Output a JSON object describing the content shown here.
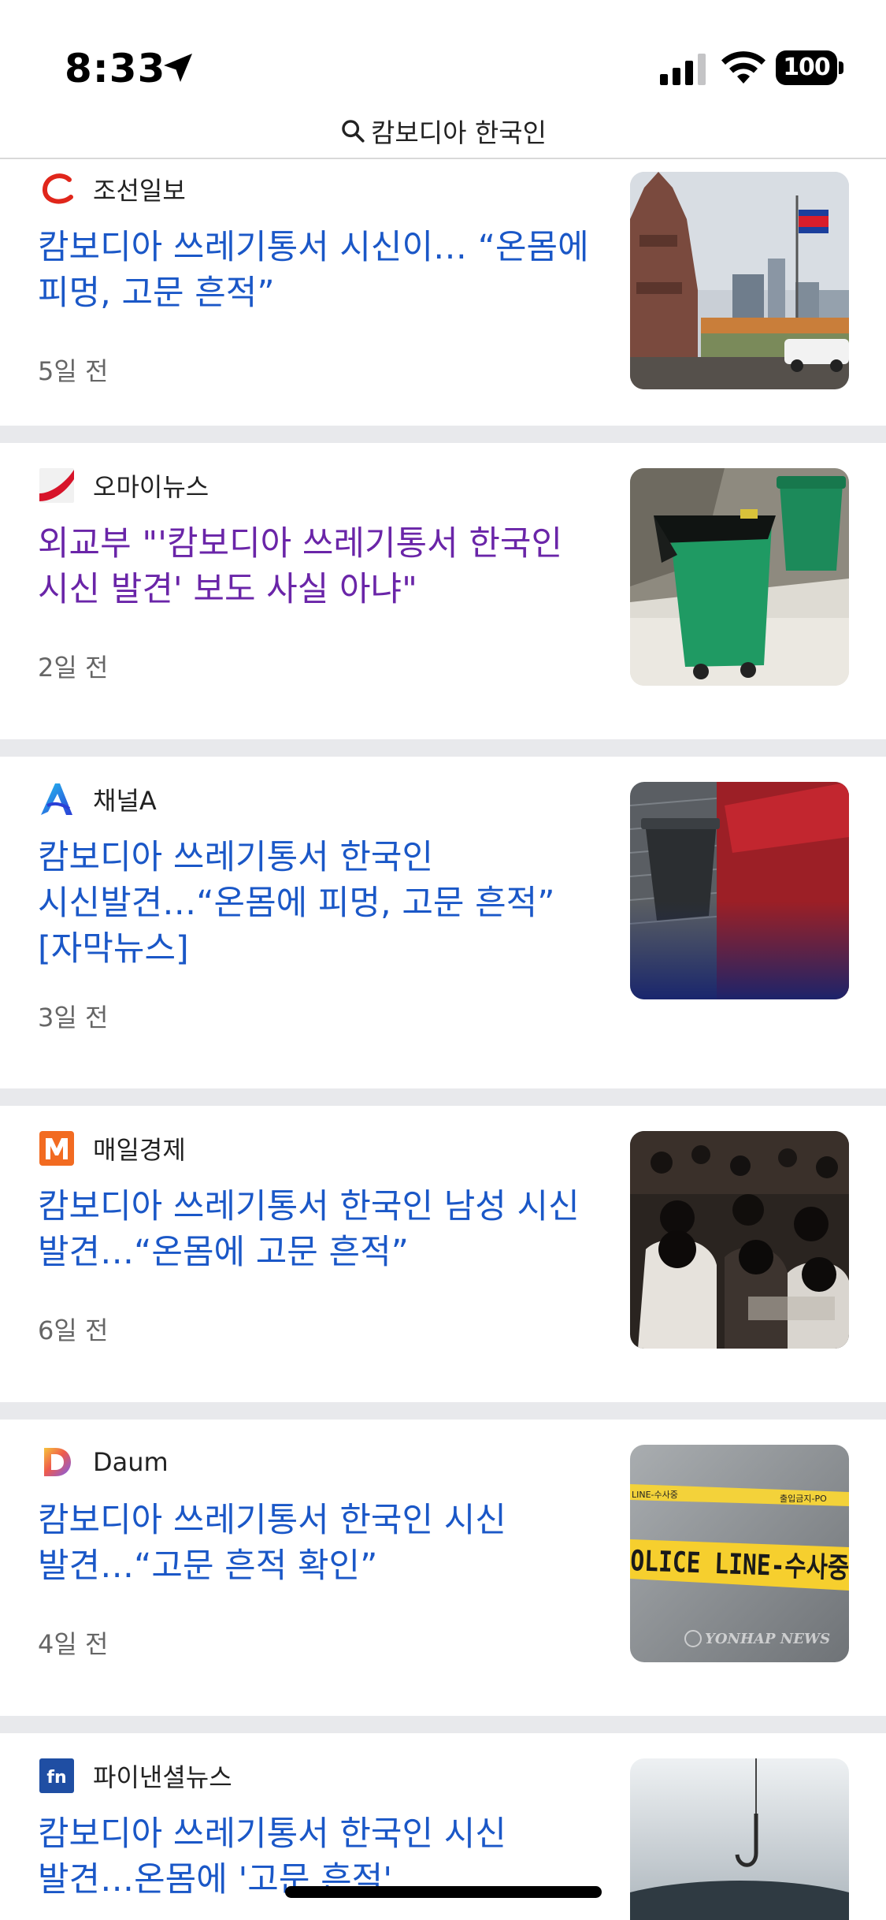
{
  "status_bar": {
    "time": "8:33",
    "battery": "100",
    "icons": [
      "location-arrow-icon",
      "cellular-signal-icon",
      "wifi-icon",
      "battery-icon"
    ]
  },
  "search": {
    "query": "캄보디아 한국인",
    "icon": "search-icon"
  },
  "colors": {
    "headline": "#1a57c7",
    "headline_visited": "#6a25a8",
    "separator": "#e8e9ec",
    "meta_text": "#666666"
  },
  "articles": [
    {
      "source": "조선일보",
      "logo": "chosun-logo-icon",
      "headline": "캄보디아 쓰레기통서 시신이… “온몸에 피멍, 고문 흔적”",
      "age": "5일 전",
      "visited": false,
      "image": "independence-monument-photo"
    },
    {
      "source": "오마이뉴스",
      "logo": "ohmynews-logo-icon",
      "headline": "외교부 \"'캄보디아 쓰레기통서 한국인 시신 발견' 보도 사실 아냐\"",
      "age": "2일 전",
      "visited": true,
      "image": "green-trash-bins-photo"
    },
    {
      "source": "채널A",
      "logo": "channel-a-logo-icon",
      "headline": "캄보디아 쓰레기통서 한국인 시신발견…“온몸에 피멍, 고문 흔적” [자막뉴스]",
      "age": "3일 전",
      "visited": false,
      "image": "trash-bin-news-still-photo"
    },
    {
      "source": "매일경제",
      "logo": "maeil-business-logo-icon",
      "headline": "캄보디아 쓰레기통서 한국인 남성 시신 발견…“온몸에 고문 흔적”",
      "age": "6일 전",
      "visited": false,
      "image": "crowd-seated-photo"
    },
    {
      "source": "Daum",
      "logo": "daum-logo-icon",
      "headline": "캄보디아 쓰레기통서 한국인 시신 발견…“고문 흔적 확인”",
      "age": "4일 전",
      "visited": false,
      "image": "police-line-tape-photo",
      "image_text": {
        "tape_main": "OLICE LINE-수사중",
        "tape_top_left": "LINE-수사중",
        "tape_top_right": "출입금지-PO",
        "watermark": "YONHAP NEWS"
      }
    },
    {
      "source": "파이낸셜뉴스",
      "logo": "financial-news-logo-icon",
      "headline": "캄보디아 쓰레기통서 한국인 시신 발견…온몸에 '고문 흔적'",
      "age": "",
      "visited": false,
      "image": "fish-hook-photo"
    }
  ]
}
